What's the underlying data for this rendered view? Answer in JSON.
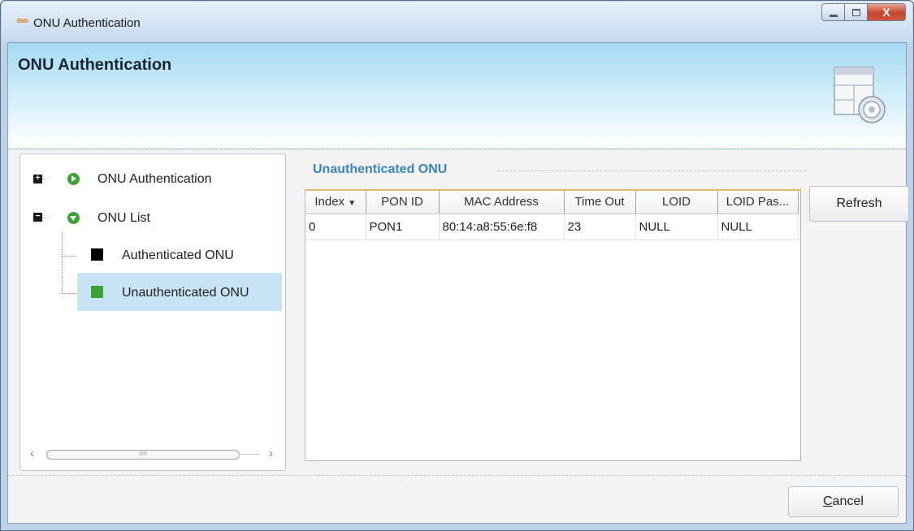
{
  "window": {
    "title": "ONU Authentication",
    "app_icon_text": "EMS",
    "buttons": {
      "minimize": "–",
      "maximize": "□",
      "close": "X"
    }
  },
  "banner": {
    "title": "ONU Authentication"
  },
  "tree": {
    "items": [
      {
        "label": "ONU Authentication",
        "expander": "+",
        "icon": "play-circle-icon"
      },
      {
        "label": "ONU List",
        "expander": "−",
        "icon": "chevron-down-circle-icon"
      },
      {
        "label": "Authenticated ONU",
        "color": "#000000"
      },
      {
        "label": "Unauthenticated ONU",
        "color": "#3aa334"
      }
    ],
    "scrollbar_thumb": "IIIII"
  },
  "section": {
    "title": "Unauthenticated ONU"
  },
  "table": {
    "columns": [
      "Index",
      "PON ID",
      "MAC Address",
      "Time Out",
      "LOID",
      "LOID Pas..."
    ],
    "rows": [
      [
        "0",
        "PON1",
        "80:14:a8:55:6e:f8",
        "23",
        "NULL",
        "NULL"
      ]
    ]
  },
  "buttons": {
    "refresh": "Refresh",
    "cancel": "Cancel",
    "cancel_mnemonic": "C",
    "cancel_rest": "ancel"
  },
  "colors": {
    "accent": "#3a84bc",
    "selection": "#c8e3f5",
    "header_orange": "#e6b96a"
  }
}
